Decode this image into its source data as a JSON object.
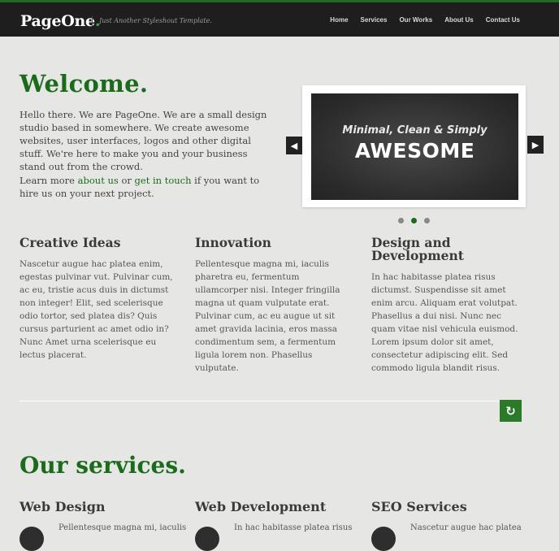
{
  "header": {
    "logo": "PageOne",
    "logo_dot": ".",
    "tagline": "Just Another Styleshout Template.",
    "nav": [
      "Home",
      "Services",
      "Our Works",
      "About Us",
      "Contact Us"
    ]
  },
  "welcome": {
    "title": "Welcome.",
    "intro": "Hello there. We are PageOne. We are a small design studio based in somewhere. We create awesome websites, user interfaces, logos and other digital stuff. We're here to make you and your business stand out from the crowd.",
    "learn_prefix": "Learn more ",
    "about_link": "about us",
    "or_text": " or ",
    "touch_link": "get in touch",
    "learn_suffix": " if you want to hire us on your next project."
  },
  "slider": {
    "subtitle": "Minimal, Clean & Simply",
    "headline": "AWESOME",
    "prev_glyph": "◀",
    "next_glyph": "▶",
    "active_dot": 1,
    "dot_count": 3
  },
  "features": [
    {
      "title": "Creative Ideas",
      "text": "Nascetur augue hac platea enim, egestas pulvinar vut. Pulvinar cum, ac eu, tristie acus duis in dictumst non integer! Elit, sed scelerisque odio tortor, sed platea dis? Quis cursus parturient ac amet odio in? Nunc Amet urna scelerisque eu lectus placerat."
    },
    {
      "title": "Innovation",
      "text": "Pellentesque magna mi, iaculis pharetra eu, fermentum ullamcorper nisi. Integer fringilla magna ut quam vulputate erat. Pulvinar cum, ac eu augue ut sit amet gravida lacinia, eros massa condimentum sem, a fermentum ligula lorem non. Phasellus vulputate."
    },
    {
      "title": "Design and Development",
      "text": "In hac habitasse platea risus dictumst. Suspendisse sit amet enim arcu. Aliquam erat volutpat. Phasellus a dui nisi. Nunc nec quam vitae nisl vehicula euismod. Lorem ipsum dolor sit amet, consectetur adipiscing elit. Sed commodo ligula blandit risus."
    }
  ],
  "back_to_top_glyph": "↻",
  "services": {
    "title": "Our services.",
    "items": [
      {
        "title": "Web Design",
        "text": "Pellentesque magna mi, iaculis"
      },
      {
        "title": "Web Development",
        "text": "In hac habitasse platea risus"
      },
      {
        "title": "SEO Services",
        "text": "Nascetur augue hac platea"
      }
    ]
  },
  "colors": {
    "accent": "#1c6b1c",
    "header_bg": "#1e1e1e",
    "page_bg": "#e6e6e4"
  }
}
